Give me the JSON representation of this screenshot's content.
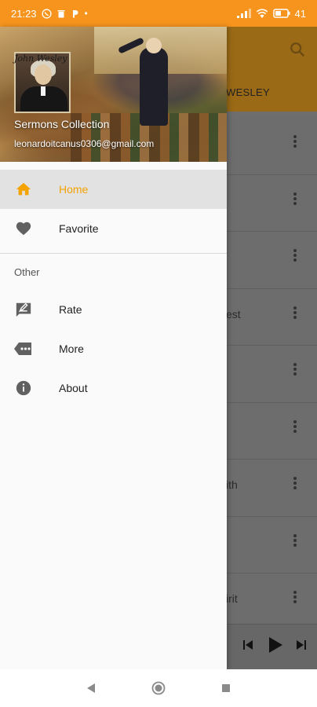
{
  "status_bar": {
    "time": "21:23",
    "battery": "41"
  },
  "background": {
    "toolbar_title": "WESLEY",
    "rows": [
      "",
      "",
      "",
      "est",
      "",
      "",
      "ith",
      "",
      "irit"
    ]
  },
  "drawer": {
    "header": {
      "signature": "John Wesley",
      "title": "Sermons Collection",
      "email": "leonardoitcanus0306@gmail.com"
    },
    "items": [
      {
        "label": "Home",
        "icon": "home-icon",
        "active": true
      },
      {
        "label": "Favorite",
        "icon": "heart-icon",
        "active": false
      }
    ],
    "section_label": "Other",
    "other_items": [
      {
        "label": "Rate",
        "icon": "rate-icon"
      },
      {
        "label": "More",
        "icon": "more-icon"
      },
      {
        "label": "About",
        "icon": "info-icon"
      }
    ]
  },
  "colors": {
    "accent": "#f4a300",
    "status_bar": "#f7941d"
  }
}
